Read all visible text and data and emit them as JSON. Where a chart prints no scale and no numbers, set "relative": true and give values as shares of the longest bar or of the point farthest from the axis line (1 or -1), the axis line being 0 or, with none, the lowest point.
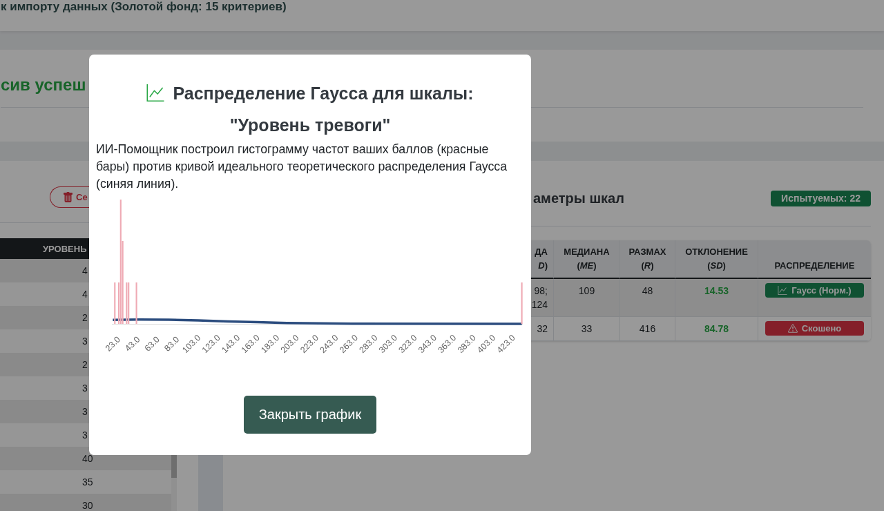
{
  "header": {
    "title": "к импорту данных (Золотой фонд: 15 критериев)"
  },
  "status_card": {
    "message": "сив успеш"
  },
  "levels_panel": {
    "delete_button": {
      "label": "Се"
    },
    "table": {
      "columns": [
        "УРОВЕНЬ"
      ],
      "rows": [
        {
          "value": "4"
        },
        {
          "value": "4"
        },
        {
          "value": "2"
        },
        {
          "value": "3"
        },
        {
          "value": "2"
        },
        {
          "value": "3"
        },
        {
          "value": "3"
        },
        {
          "value": "3"
        },
        {
          "value": "40"
        },
        {
          "value": "35"
        },
        {
          "value": "30"
        }
      ]
    }
  },
  "scales_panel": {
    "title": "аметры шкал",
    "subjects_badge": "Испытуемых: 22",
    "table": {
      "columns": [
        "ДА *D*)",
        "МЕДИАНА (*ME*)",
        "РАЗМАХ (*R*)",
        "ОТКЛОНЕНИЕ (*SD*)",
        "РАСПРЕДЕЛЕНИЕ"
      ],
      "rows": [
        {
          "cells": [
            "98; 124",
            "109",
            "48",
            "14.53"
          ],
          "distribution": {
            "kind": "normal",
            "label": "Гаусс (Норм.)"
          }
        },
        {
          "cells": [
            "32",
            "33",
            "416",
            "84.78"
          ],
          "distribution": {
            "kind": "skewed",
            "label": "Скошено"
          }
        }
      ]
    }
  },
  "modal": {
    "title": "Распределение Гаусса для шкалы:",
    "scale_name": "\"Уровень тревоги\"",
    "description": "ИИ-Помощник построил гистограмму частот ваших баллов (красные бары) против кривой идеального теоретического распределения Гаусса (синяя линия).",
    "chart_data": {
      "type": "bar",
      "relative": true,
      "xlim": [
        22,
        440
      ],
      "xticks": [
        {
          "value": 23,
          "label": "23.0"
        },
        {
          "value": 43,
          "label": "43.0"
        },
        {
          "value": 63,
          "label": "63.0"
        },
        {
          "value": 83,
          "label": "83.0"
        },
        {
          "value": 103,
          "label": "103.0"
        },
        {
          "value": 123,
          "label": "123.0"
        },
        {
          "value": 143,
          "label": "143.0"
        },
        {
          "value": 163,
          "label": "163.0"
        },
        {
          "value": 183,
          "label": "183.0"
        },
        {
          "value": 203,
          "label": "203.0"
        },
        {
          "value": 223,
          "label": "223.0"
        },
        {
          "value": 243,
          "label": "243.0"
        },
        {
          "value": 263,
          "label": "263.0"
        },
        {
          "value": 283,
          "label": "283.0"
        },
        {
          "value": 303,
          "label": "303.0"
        },
        {
          "value": 323,
          "label": "323.0"
        },
        {
          "value": 343,
          "label": "343.0"
        },
        {
          "value": 363,
          "label": "363.0"
        },
        {
          "value": 383,
          "label": "383.0"
        },
        {
          "value": 403,
          "label": "403.0"
        },
        {
          "value": 423,
          "label": "423.0"
        }
      ],
      "series": [
        {
          "color": "#efaab4",
          "x": [
            25,
            29,
            31,
            33,
            37,
            39,
            47,
            439
          ],
          "values": [
            0.333,
            0.333,
            1,
            0.667,
            0.333,
            0.333,
            0.333,
            0.333
          ]
        },
        {
          "type": "line",
          "color": "#2b4c7e",
          "x": [
            23,
            50,
            80,
            110,
            140,
            170,
            200,
            250,
            439
          ],
          "values": [
            0.0325,
            0.0345,
            0.0327,
            0.0273,
            0.0202,
            0.0132,
            0.0075,
            0.0023,
            0
          ]
        }
      ]
    },
    "close_button": "Закрыть график"
  }
}
